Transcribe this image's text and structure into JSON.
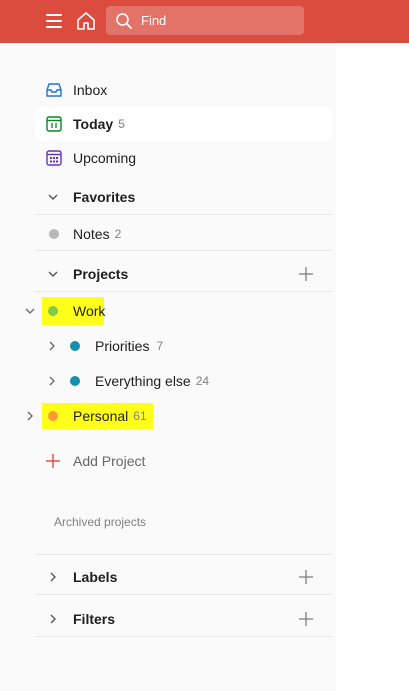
{
  "topbar": {
    "search_placeholder": "Find",
    "accent": "#db4c3f"
  },
  "nav": {
    "inbox": {
      "label": "Inbox",
      "icon": "inbox-icon"
    },
    "today": {
      "label": "Today",
      "count": "5",
      "icon": "calendar-today-icon"
    },
    "upcoming": {
      "label": "Upcoming",
      "icon": "calendar-grid-icon"
    }
  },
  "favorites": {
    "title": "Favorites",
    "items": [
      {
        "label": "Notes",
        "count": "2",
        "color": "#b8b8b8"
      }
    ]
  },
  "projects": {
    "title": "Projects",
    "work": {
      "label": "Work",
      "color": "#7ecc49"
    },
    "priorities": {
      "label": "Priorities",
      "count": "7",
      "color": "#158fad"
    },
    "everything_else": {
      "label": "Everything else",
      "count": "24",
      "color": "#158fad"
    },
    "personal": {
      "label": "Personal",
      "count": "61",
      "color": "#ff9933"
    },
    "add_label": "Add Project",
    "archived_label": "Archived projects"
  },
  "labels": {
    "title": "Labels"
  },
  "filters": {
    "title": "Filters"
  },
  "highlight_color": "#ffff1a"
}
